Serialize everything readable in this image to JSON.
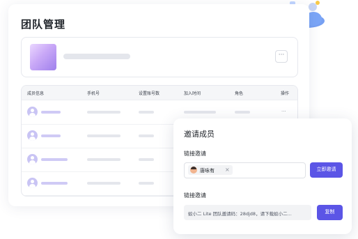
{
  "page": {
    "title": "团队管理"
  },
  "team": {
    "more_label": "···"
  },
  "table": {
    "headers": [
      "成员信息",
      "手机号",
      "设置账号数",
      "加入时间",
      "角色",
      "操作"
    ],
    "row_action": "···"
  },
  "invite_panel": {
    "title": "邀请成员",
    "section1_label": "链接邀请",
    "invitee_name": "唐咏有",
    "remove_glyph": "×",
    "invite_now_label": "立即邀请",
    "section2_label": "链接邀请",
    "link_text": "蚁小二 Lite 团队邀请码：28djd8，请下载蚁小二...",
    "copy_label": "复制"
  },
  "colors": {
    "accent": "#5b55e6",
    "placeholder": "#e4e6ec",
    "avatar": "#c9c4f4"
  },
  "icons": {
    "more": "more-icon",
    "avatar": "user-avatar-icon",
    "close": "close-icon"
  }
}
